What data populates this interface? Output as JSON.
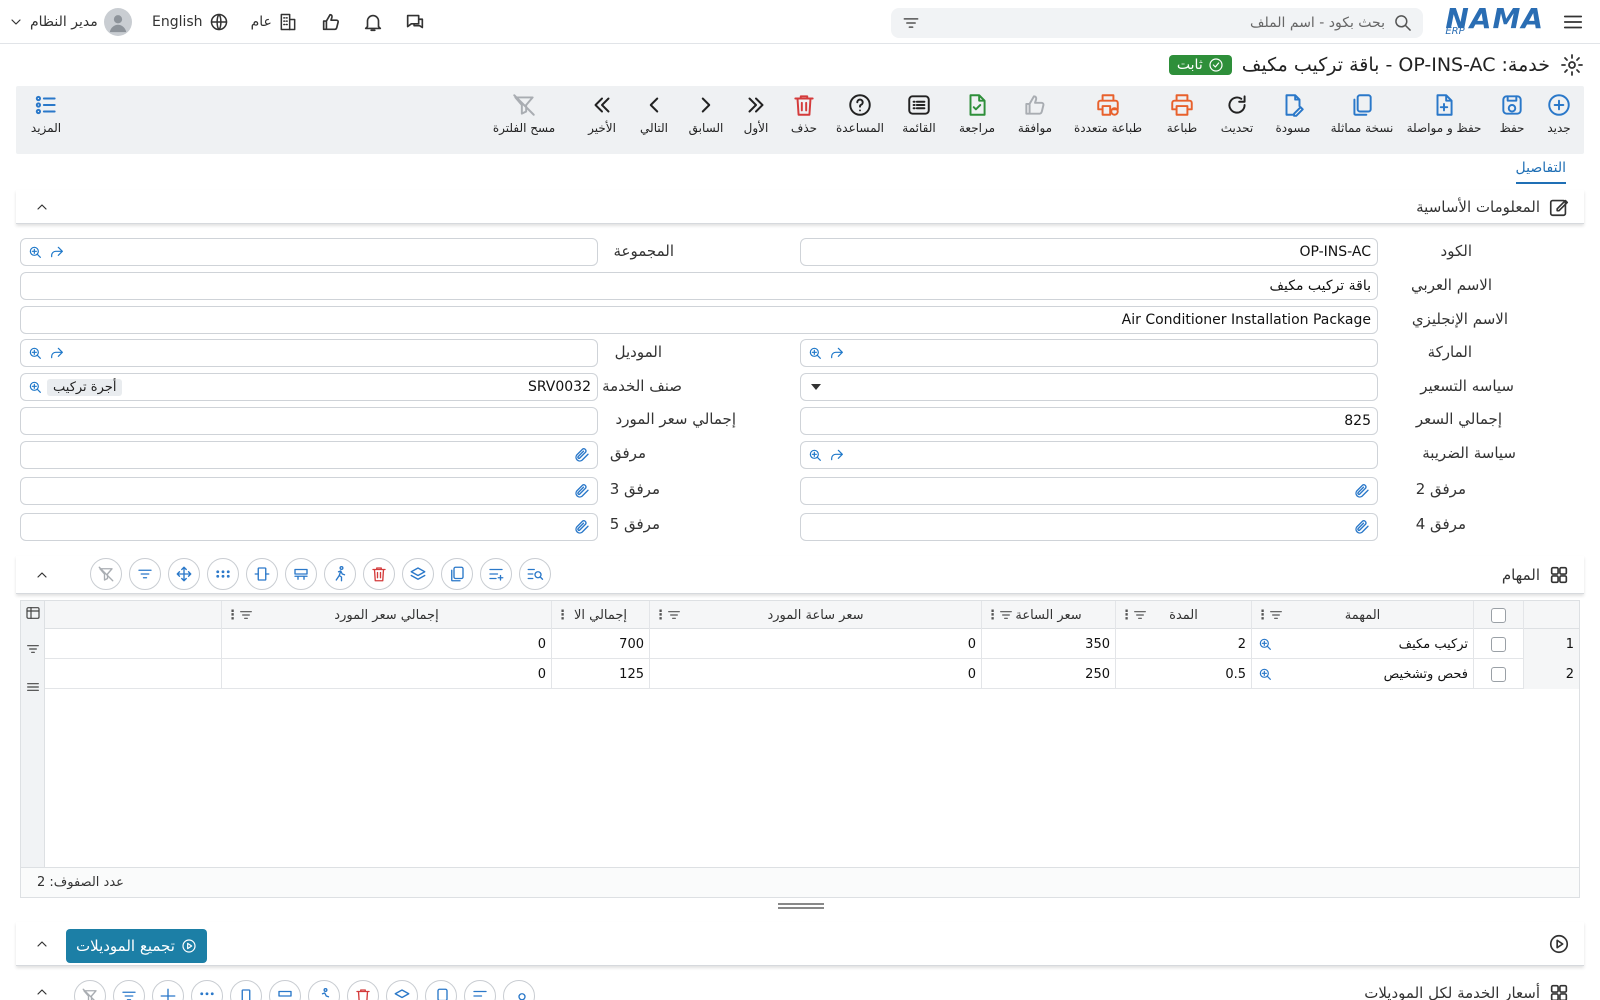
{
  "topbar": {
    "logo_text": "NAMA",
    "logo_sub": "ERP",
    "search_placeholder": "بحث بكود - اسم الملف",
    "user_name": "مدير النظام",
    "language": "English",
    "branch": "عام"
  },
  "title": {
    "text": "خدمة: OP-INS-AC - باقة تركيب مكيف",
    "status": "ثابت"
  },
  "toolbar": {
    "new": "جديد",
    "save": "حفظ",
    "save_continue": "حفظ و مواصلة",
    "duplicate": "نسخة مماثلة",
    "draft": "مسودة",
    "refresh": "تحديث",
    "print": "طباعة",
    "multi_print": "طباعة متعددة",
    "approve": "موافقة",
    "review": "مراجعة",
    "list": "القائمة",
    "help": "المساعدة",
    "delete": "حذف",
    "first": "الأول",
    "previous": "السابق",
    "next": "التالي",
    "last": "الأخير",
    "clear_filter": "مسح الفلترة",
    "more": "المزيد"
  },
  "tabs": {
    "details": "التفاصيل"
  },
  "basic_info": {
    "title": "المعلومات الأساسية",
    "labels": {
      "code": "الكود",
      "arabic_name": "الاسم العربي",
      "english_name": "الاسم الإنجليزي",
      "brand": "الماركة",
      "pricing_policy": "سياسه التسعير",
      "total_price": "إجمالي السعر",
      "tax_policy": "سياسة الضريبة",
      "attachment2": "مرفق 2",
      "attachment4": "مرفق 4",
      "group": "المجموعة",
      "model": "الموديل",
      "service_class": "صنف الخدمة",
      "supplier_total": "إجمالي سعر المورد",
      "attachment": "مرفق",
      "attachment3": "مرفق 3",
      "attachment5": "مرفق 5"
    },
    "values": {
      "code": "OP-INS-AC",
      "arabic_name": "باقة تركيب مكيف",
      "english_name": "Air Conditioner Installation Package",
      "total_price": "825",
      "service_class_code": "SRV0032",
      "service_class_name": "أجرة تركيب"
    }
  },
  "tasks": {
    "title": "المهام",
    "columns": [
      "المهمة",
      "المدة",
      "سعر الساعة",
      "سعر ساعة المورد",
      "إجمالي الا",
      "إجمالي سعر المورد"
    ],
    "rows": [
      {
        "n": "1",
        "task": "تركيب مكيف",
        "duration": "2",
        "hour_price": "350",
        "supplier_hour": "0",
        "total": "700",
        "supplier_total": "0"
      },
      {
        "n": "2",
        "task": "فحص وتشخيص",
        "duration": "0.5",
        "hour_price": "250",
        "supplier_hour": "0",
        "total": "125",
        "supplier_total": "0"
      }
    ],
    "row_count": "عدد الصفوف: 2"
  },
  "models_section": {
    "button": "تجميع الموديلات",
    "next_section_title": "أسعار الخدمة لكل الموديلات"
  },
  "colors": {
    "primary": "#2a78c9",
    "status_green": "#2e8f3a",
    "print_orange": "#e8612c",
    "delete_red": "#d43b3b",
    "action_teal": "#1c7fa6"
  }
}
